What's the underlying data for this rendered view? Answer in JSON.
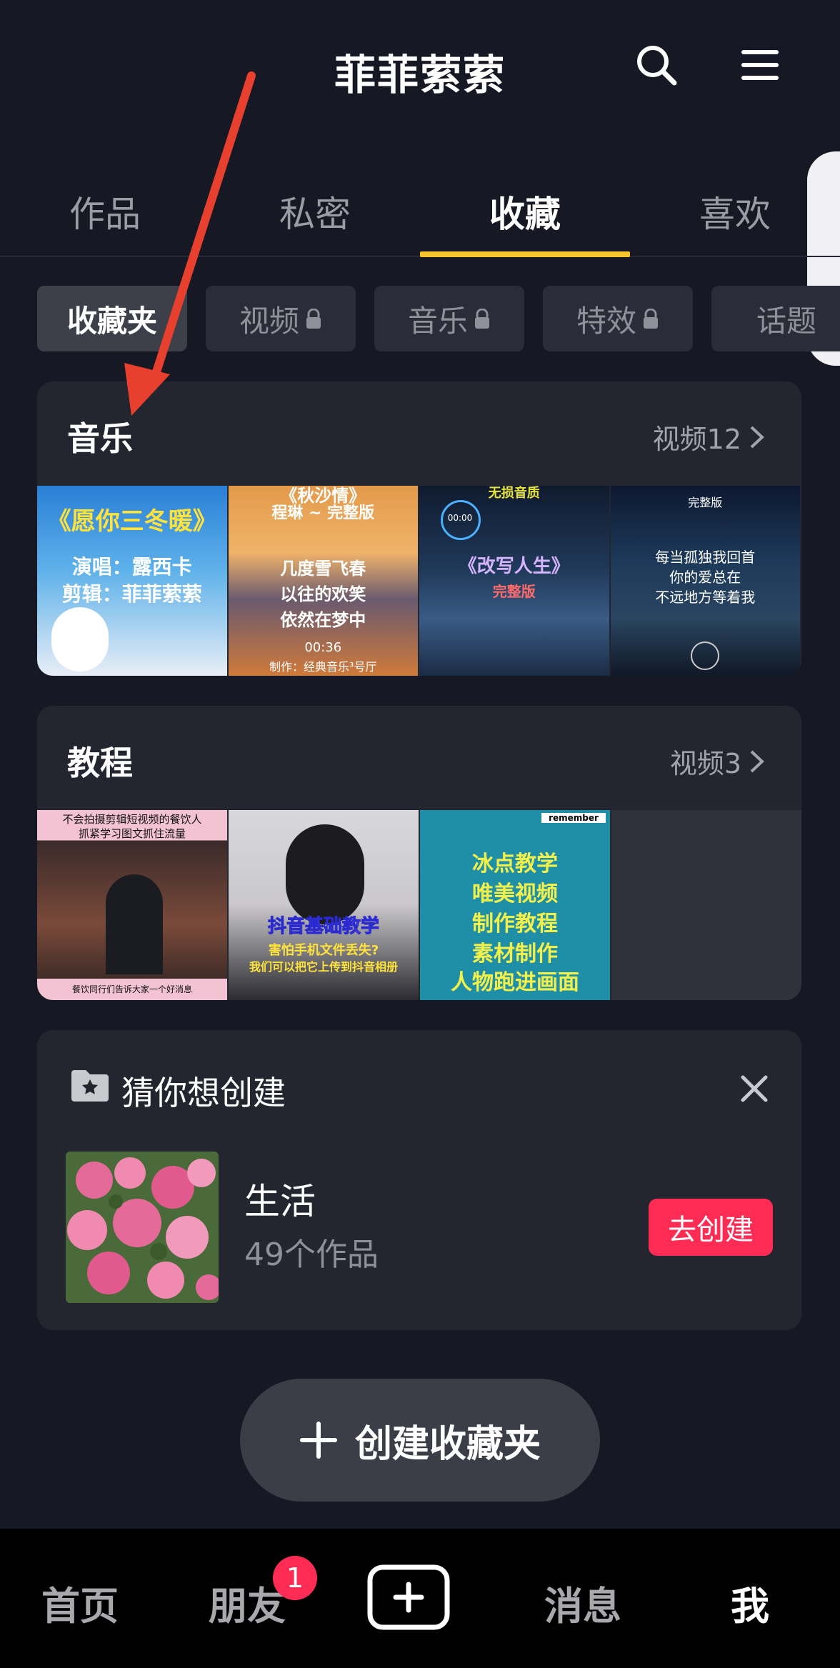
{
  "header": {
    "title": "菲菲萦萦",
    "search_icon": "search-icon",
    "menu_icon": "menu-icon"
  },
  "tabs": [
    {
      "label": "作品",
      "active": false
    },
    {
      "label": "私密",
      "active": false
    },
    {
      "label": "收藏",
      "active": true
    },
    {
      "label": "喜欢",
      "active": false
    }
  ],
  "chips": [
    {
      "label": "收藏夹",
      "active": true,
      "locked": false
    },
    {
      "label": "视频",
      "active": false,
      "locked": true
    },
    {
      "label": "音乐",
      "active": false,
      "locked": true
    },
    {
      "label": "特效",
      "active": false,
      "locked": true
    },
    {
      "label": "话题",
      "active": false,
      "locked": false
    }
  ],
  "folders": [
    {
      "title": "音乐",
      "meta": "视频12",
      "thumbs": [
        {
          "lines": [
            "《愿你三冬暖》",
            "演唱：露西卡",
            "剪辑：菲菲萦萦"
          ]
        },
        {
          "lines": [
            "《秋沙情》",
            "程琳 ~ 完整版",
            "几度雪飞春",
            "以往的欢笑",
            "依然在梦中",
            "00:36",
            "制作：经典音乐³号厅"
          ]
        },
        {
          "lines": [
            "无损音质",
            "00:00",
            "《改写人生》",
            "完整版"
          ]
        },
        {
          "lines": [
            "完整版",
            "每当孤独我回首",
            "你的爱总在",
            "不远地方等着我"
          ]
        }
      ]
    },
    {
      "title": "教程",
      "meta": "视频3",
      "thumbs": [
        {
          "lines": [
            "不会拍摄剪辑短视频的餐饮人",
            "抓紧学习图文抓住流量",
            "餐饮同行们告诉大家一个好消息"
          ]
        },
        {
          "lines": [
            "抖音基础教学",
            "害怕手机文件丢失?",
            "我们可以把它上传到抖音相册"
          ]
        },
        {
          "lines": [
            "remember",
            "冰点教学",
            "唯美视频",
            "制作教程",
            "素材制作",
            "人物跑进画面"
          ]
        }
      ]
    }
  ],
  "suggest": {
    "title": "猜你想创建",
    "name": "生活",
    "count": "49个作品",
    "button": "去创建"
  },
  "new_folder": {
    "label": "创建收藏夹"
  },
  "bottom_nav": [
    {
      "label": "首页",
      "active": false
    },
    {
      "label": "朋友",
      "active": false,
      "badge": "1"
    },
    {
      "label": "消息",
      "active": false
    },
    {
      "label": "我",
      "active": true
    }
  ],
  "colors": {
    "accent": "#f7c52b",
    "primary": "#fe2c55",
    "background": "#161823",
    "annotation": "#e8402e"
  }
}
